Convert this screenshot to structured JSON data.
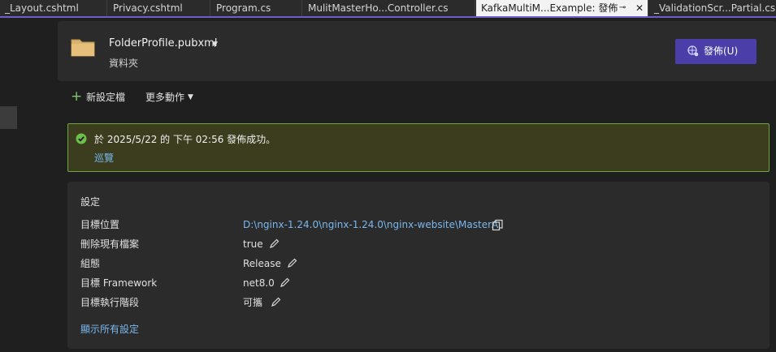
{
  "tabs": [
    {
      "label": "_Layout.cshtml"
    },
    {
      "label": "Privacy.cshtml"
    },
    {
      "label": "Program.cs"
    },
    {
      "label": "MulitMasterHo...Controller.cs"
    },
    {
      "label": "KafkaMultiM...Example: 發佈",
      "active": true
    },
    {
      "label": "_ValidationScr...Partial.cshtml"
    }
  ],
  "header": {
    "profile_name": "FolderProfile.pubxml",
    "profile_type": "資料夾",
    "publish_label": "發佈(U)"
  },
  "actions": {
    "new_profile": "新設定檔",
    "more_actions": "更多動作"
  },
  "banner": {
    "message": "於 2025/5/22 的 下午 02:56 發佈成功。",
    "link": "巡覽"
  },
  "settings": {
    "title": "設定",
    "rows": [
      {
        "label": "目標位置",
        "value": "D:\\nginx-1.24.0\\nginx-1.24.0\\nginx-website\\MasterA"
      },
      {
        "label": "刪除現有檔案",
        "value": "true"
      },
      {
        "label": "組態",
        "value": "Release"
      },
      {
        "label": "目標 Framework",
        "value": "net8.0"
      },
      {
        "label": "目標執行階段",
        "value": "可攜"
      }
    ],
    "show_all": "顯示所有設定"
  },
  "colors": {
    "accent": "#4b3ea8",
    "success_border": "#6ba73f",
    "success_bg": "#3b3d1e",
    "link": "#79b8ee"
  }
}
